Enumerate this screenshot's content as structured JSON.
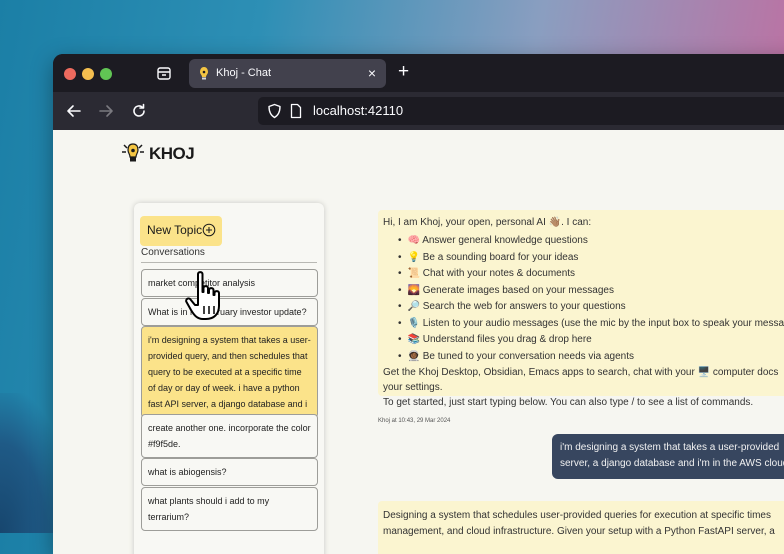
{
  "colors": {
    "accent_yellow": "#fbe38a",
    "message_bg": "#fbf5d0",
    "user_bubble": "#37465f",
    "browser_chrome": "#1c1b22"
  },
  "browser": {
    "tab": {
      "title": "Khoj - Chat",
      "close_glyph": "×",
      "favicon": "khoj-lamp-icon"
    },
    "new_tab_glyph": "+",
    "url": "localhost:42110",
    "icons": [
      "back-arrow-icon",
      "forward-arrow-icon",
      "reload-icon",
      "shield-icon",
      "page-icon",
      "tab-list-icon"
    ]
  },
  "app": {
    "logo_text": "KHOJ",
    "sidebar": {
      "new_topic_label": "New Topic",
      "conversations_heading": "Conversations",
      "conversations": [
        {
          "title": "market competitor analysis",
          "selected": false
        },
        {
          "title": "What is in my february investor update?",
          "selected": false
        },
        {
          "title": "i'm designing a system that takes a user-provided query, and then schedules that query to be executed at a specific time of day or day of week. i have a python fast API server, a django database and i",
          "selected": true
        },
        {
          "title": "create another one. incorporate the color #f9f5de.",
          "selected": false
        },
        {
          "title": "what is abiogensis?",
          "selected": false
        },
        {
          "title": "what plants should i add to my terrarium?",
          "selected": false
        }
      ]
    },
    "chat": {
      "greeting": "Hi, I am Khoj, your open, personal AI 👋🏽. I can:",
      "capabilities": [
        "🧠 Answer general knowledge questions",
        "💡 Be a sounding board for your ideas",
        "📜 Chat with your notes & documents",
        "🌄 Generate images based on your messages",
        "🔎 Search the web for answers to your questions",
        "🎙️ Listen to your audio messages (use the mic by the input box to speak your messages)",
        "📚 Understand files you drag & drop here",
        "👩🏾‍🚀 Be tuned to your conversation needs via agents"
      ],
      "closing_line1": "Get the Khoj Desktop, Obsidian, Emacs apps to search, chat with your 🖥️ computer docs",
      "closing_line2": "your settings.",
      "closing_line3": "To get started, just start typing below. You can also type / to see a list of commands.",
      "timestamp": "Khoj at 10:43, 29 Mar 2024",
      "user_message_line1": "i'm designing a system that takes a user-provided",
      "user_message_line2": "server, a django database and i'm in the AWS cloud",
      "reply_line1": "Designing a system that schedules user-provided queries for execution at specific times",
      "reply_line2": "management, and cloud infrastructure. Given your setup with a Python FastAPI server, a"
    }
  }
}
